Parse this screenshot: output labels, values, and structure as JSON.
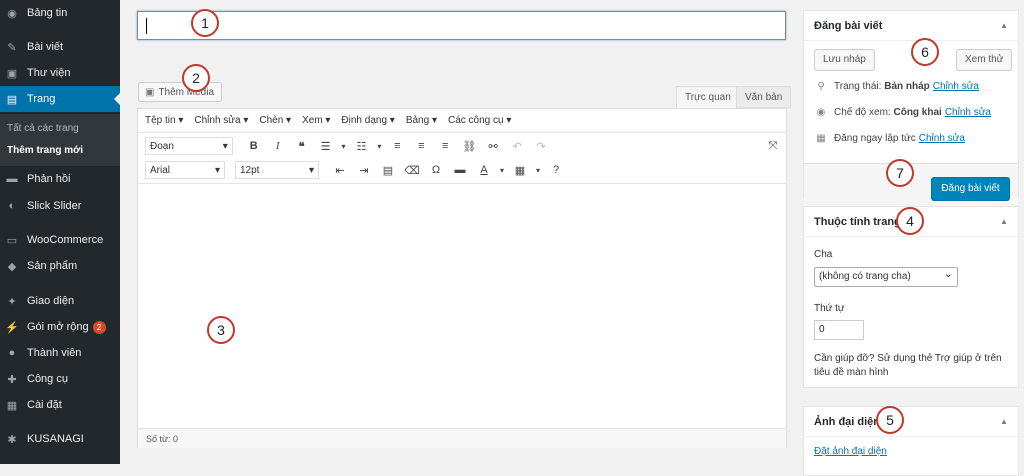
{
  "sidebar": {
    "items": [
      {
        "label": "Bảng tin",
        "icon": "dashboard-icon",
        "glyph": "◉"
      },
      {
        "label": "Bài viết",
        "icon": "pin-icon",
        "glyph": "✎"
      },
      {
        "label": "Thư viện",
        "icon": "media-icon",
        "glyph": "▣"
      },
      {
        "label": "Trang",
        "icon": "page-icon",
        "glyph": "▤"
      },
      {
        "label": "Phản hồi",
        "icon": "comment-icon",
        "glyph": "▬"
      },
      {
        "label": "Slick Slider",
        "icon": "slider-icon",
        "glyph": "◐"
      },
      {
        "label": "WooCommerce",
        "icon": "woocommerce-icon",
        "glyph": "▭"
      },
      {
        "label": "Sản phẩm",
        "icon": "product-icon",
        "glyph": "◆"
      },
      {
        "label": "Giao diện",
        "icon": "appearance-icon",
        "glyph": "✦"
      },
      {
        "label": "Gói mở rộng",
        "icon": "plugin-icon",
        "glyph": "⚡"
      },
      {
        "label": "Thành viên",
        "icon": "users-icon",
        "glyph": "●"
      },
      {
        "label": "Công cụ",
        "icon": "tools-icon",
        "glyph": "✚"
      },
      {
        "label": "Cài đặt",
        "icon": "settings-icon",
        "glyph": "▦"
      },
      {
        "label": "KUSANAGI",
        "icon": "gear-icon",
        "glyph": "✱"
      }
    ],
    "plugin_badge": "2",
    "submenu": [
      "Tất cả các trang",
      "Thêm trang mới"
    ]
  },
  "editor": {
    "add_media": "Thêm Media",
    "tab_visual": "Trực quan",
    "tab_text": "Văn bản",
    "menus": [
      "Tệp tin ▾",
      "Chỉnh sửa ▾",
      "Chèn ▾",
      "Xem ▾",
      "Định dạng ▾",
      "Bảng ▾",
      "Các công cụ ▾"
    ],
    "format_select": "Đoạn",
    "font_select": "Arial",
    "size_select": "12pt",
    "word_count": "Số từ: 0"
  },
  "publish": {
    "title": "Đăng bài viết",
    "save_draft": "Lưu nháp",
    "preview": "Xem thử",
    "status_label": "Trạng thái:",
    "status_value": "Bản nháp",
    "visibility_label": "Chế độ xem:",
    "visibility_value": "Công khai",
    "schedule_label": "Đăng ngay lập tức",
    "edit_link": "Chỉnh sửa",
    "publish_button": "Đăng bài viết"
  },
  "page_attributes": {
    "title": "Thuộc tính trang",
    "parent_label": "Cha",
    "parent_value": "(không có trang cha)",
    "order_label": "Thứ tự",
    "order_value": "0",
    "help_text_1": "Cần giúp đỡ? Sử dụng thẻ Trợ giúp ở trên",
    "help_text_2": "tiêu đề màn hình"
  },
  "featured_image": {
    "title": "Ảnh đại diện",
    "set_link": "Đặt ảnh đại diện"
  },
  "annotations": [
    "1",
    "2",
    "3",
    "4",
    "5",
    "6",
    "7"
  ],
  "colors": {
    "accent": "#0073aa",
    "sidebar": "#23282d",
    "marker": "#c0392b"
  }
}
